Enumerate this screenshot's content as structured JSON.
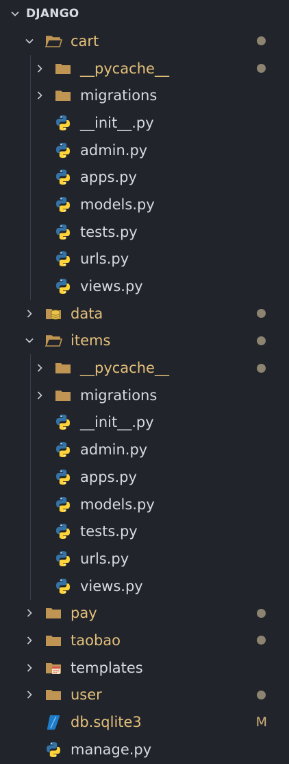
{
  "section": {
    "title": "DJANGO"
  },
  "tree": [
    {
      "name": "cart",
      "kind": "folder-open",
      "depth": 0,
      "expanded": true,
      "status": "dot"
    },
    {
      "name": "__pycache__",
      "kind": "folder",
      "depth": 1,
      "expanded": false,
      "status": "dot"
    },
    {
      "name": "migrations",
      "kind": "folder",
      "depth": 1,
      "expanded": false,
      "status": ""
    },
    {
      "name": "__init__.py",
      "kind": "python",
      "depth": 1,
      "status": ""
    },
    {
      "name": "admin.py",
      "kind": "python",
      "depth": 1,
      "status": ""
    },
    {
      "name": "apps.py",
      "kind": "python",
      "depth": 1,
      "status": ""
    },
    {
      "name": "models.py",
      "kind": "python",
      "depth": 1,
      "status": ""
    },
    {
      "name": "tests.py",
      "kind": "python",
      "depth": 1,
      "status": ""
    },
    {
      "name": "urls.py",
      "kind": "python",
      "depth": 1,
      "status": ""
    },
    {
      "name": "views.py",
      "kind": "python",
      "depth": 1,
      "status": ""
    },
    {
      "name": "data",
      "kind": "folder-data",
      "depth": 0,
      "expanded": false,
      "status": "dot"
    },
    {
      "name": "items",
      "kind": "folder-open",
      "depth": 0,
      "expanded": true,
      "status": "dot"
    },
    {
      "name": "__pycache__",
      "kind": "folder",
      "depth": 1,
      "expanded": false,
      "status": "dot"
    },
    {
      "name": "migrations",
      "kind": "folder",
      "depth": 1,
      "expanded": false,
      "status": ""
    },
    {
      "name": "__init__.py",
      "kind": "python",
      "depth": 1,
      "status": ""
    },
    {
      "name": "admin.py",
      "kind": "python",
      "depth": 1,
      "status": ""
    },
    {
      "name": "apps.py",
      "kind": "python",
      "depth": 1,
      "status": ""
    },
    {
      "name": "models.py",
      "kind": "python",
      "depth": 1,
      "status": ""
    },
    {
      "name": "tests.py",
      "kind": "python",
      "depth": 1,
      "status": ""
    },
    {
      "name": "urls.py",
      "kind": "python",
      "depth": 1,
      "status": ""
    },
    {
      "name": "views.py",
      "kind": "python",
      "depth": 1,
      "status": ""
    },
    {
      "name": "pay",
      "kind": "folder",
      "depth": 0,
      "expanded": false,
      "status": "dot"
    },
    {
      "name": "taobao",
      "kind": "folder",
      "depth": 0,
      "expanded": false,
      "status": "dot"
    },
    {
      "name": "templates",
      "kind": "folder-templates",
      "depth": 0,
      "expanded": false,
      "status": ""
    },
    {
      "name": "user",
      "kind": "folder",
      "depth": 0,
      "expanded": false,
      "status": "dot"
    },
    {
      "name": "db.sqlite3",
      "kind": "sqlite",
      "depth": 0,
      "status": "M"
    },
    {
      "name": "manage.py",
      "kind": "python",
      "depth": 0,
      "status": ""
    }
  ],
  "colors": {
    "background": "#21252b",
    "modified_label": "#e5c07b",
    "plain_label": "#d7dae0",
    "dot": "#8c8470",
    "folder": "#c09553",
    "python_blue": "#3572a5",
    "python_yellow": "#ffd43b"
  }
}
